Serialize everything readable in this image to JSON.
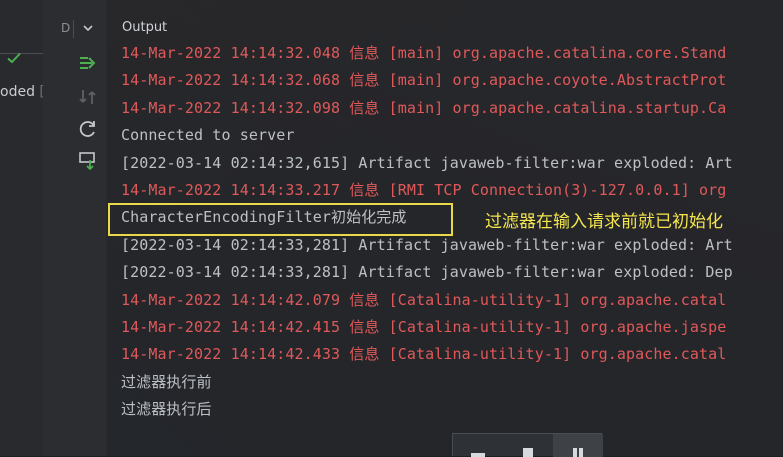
{
  "left_panel": {
    "partial_label": "oded",
    "partial_tail": "["
  },
  "tool_window": {
    "header_letter": "D",
    "buttons": [
      {
        "icon": "deploy-arrow-icon"
      },
      {
        "icon": "redeploy-icon"
      },
      {
        "icon": "refresh-icon"
      },
      {
        "icon": "download-icon"
      }
    ],
    "status_icon": "check-icon"
  },
  "output": {
    "title": "Output",
    "lines": [
      {
        "text": "14-Mar-2022 14:14:32.048 信息 [main] org.apache.catalina.core.Stand",
        "level": "red"
      },
      {
        "text": "14-Mar-2022 14:14:32.068 信息 [main] org.apache.coyote.AbstractProt",
        "level": "red"
      },
      {
        "text": "14-Mar-2022 14:14:32.098 信息 [main] org.apache.catalina.startup.Ca",
        "level": "red"
      },
      {
        "text": "Connected to server",
        "level": "grey"
      },
      {
        "text": "[2022-03-14 02:14:32,615] Artifact javaweb-filter:war exploded: Art",
        "level": "grey"
      },
      {
        "text": "14-Mar-2022 14:14:33.217 信息 [RMI TCP Connection(3)-127.0.0.1] org",
        "level": "red"
      },
      {
        "text": "CharacterEncodingFilter初始化完成",
        "level": "grey"
      },
      {
        "text": "[2022-03-14 02:14:33,281] Artifact javaweb-filter:war exploded: Art",
        "level": "grey"
      },
      {
        "text": "[2022-03-14 02:14:33,281] Artifact javaweb-filter:war exploded: Dep",
        "level": "grey"
      },
      {
        "text": "14-Mar-2022 14:14:42.079 信息 [Catalina-utility-1] org.apache.catal",
        "level": "red"
      },
      {
        "text": "14-Mar-2022 14:14:42.415 信息 [Catalina-utility-1] org.apache.jaspe",
        "level": "red"
      },
      {
        "text": "14-Mar-2022 14:14:42.433 信息 [Catalina-utility-1] org.apache.catal",
        "level": "red"
      },
      {
        "text": "过滤器执行前",
        "level": "grey"
      },
      {
        "text": "过滤器执行后",
        "level": "grey"
      }
    ],
    "annotation": "过滤器在输入请求前就已初始化"
  },
  "colors": {
    "error_text": "#e0595a",
    "normal_text": "#bcc0c5",
    "highlight": "#e8d84a",
    "annotation": "#f4e64c",
    "success": "#4caf50"
  }
}
